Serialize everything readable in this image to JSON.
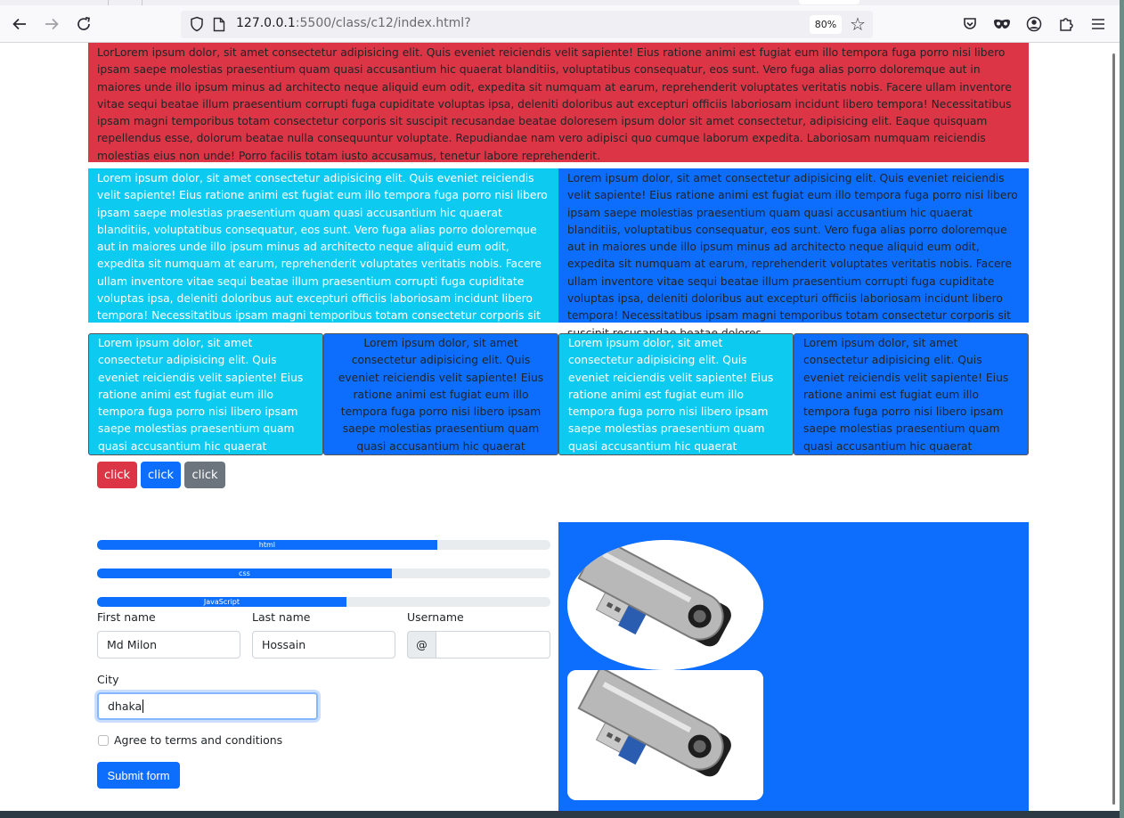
{
  "browser": {
    "url_main": "127.0.0.1",
    "url_rest": ":5500/class/c12/index.html?",
    "zoom": "80%",
    "icons": [
      "back-icon",
      "forward-icon",
      "reload-icon",
      "shield-icon",
      "page-icon",
      "star-icon",
      "pocket-icon",
      "private-mask-icon",
      "account-icon",
      "extensions-icon",
      "menu-icon"
    ]
  },
  "blocks": {
    "red_text": "LorLorem ipsum dolor, sit amet consectetur adipisicing elit. Quis eveniet reiciendis velit sapiente! Eius ratione animi est fugiat eum illo tempora fuga porro nisi libero ipsam saepe molestias praesentium quam quasi accusantium hic quaerat blanditiis, voluptatibus consequatur, eos sunt. Vero fuga alias porro doloremque aut in maiores unde illo ipsum minus ad architecto neque aliquid eum odit, expedita sit numquam at earum, reprehenderit voluptates veritatis nobis. Facere ullam inventore vitae sequi beatae illum praesentium corrupti fuga cupiditate voluptas ipsa, deleniti doloribus aut excepturi officiis laboriosam incidunt libero tempora! Necessitatibus ipsam magni temporibus totam consectetur corporis sit suscipit recusandae beatae doloresem ipsum dolor sit amet consectetur, adipisicing elit. Eaque quisquam repellendus esse, dolorum beatae nulla consequuntur voluptate. Repudiandae nam vero adipisci quo cumque laborum expedita. Laboriosam numquam reiciendis molestias eius non unde! Porro facilis totam iusto accusamus, tenetur labore reprehenderit.",
    "half_text": "Lorem ipsum dolor, sit amet consectetur adipisicing elit. Quis eveniet reiciendis velit sapiente! Eius ratione animi est fugiat eum illo tempora fuga porro nisi libero ipsam saepe molestias praesentium quam quasi accusantium hic quaerat blanditiis, voluptatibus consequatur, eos sunt. Vero fuga alias porro doloremque aut in maiores unde illo ipsum minus ad architecto neque aliquid eum odit, expedita sit numquam at earum, reprehenderit voluptates veritatis nobis. Facere ullam inventore vitae sequi beatae illum praesentium corrupti fuga cupiditate voluptas ipsa, deleniti doloribus aut excepturi officiis laboriosam incidunt libero tempora! Necessitatibus ipsam magni temporibus totam consectetur corporis sit suscipit recusandae beatae dolores.",
    "quarter_1": "Lorem ipsum dolor, sit amet consectetur adipisicing elit. Quis eveniet reiciendis velit sapiente! Eius ratione animi est fugiat eum illo tempora fuga porro nisi libero ipsam saepe molestias praesentium quam quasi accusantium hic quaerat blanditiis, voluptatibus",
    "quarter_2": "Lorem ipsum dolor, sit amet consectetur adipisicing elit. Quis eveniet reiciendis velit sapiente! Eius ratione animi est fugiat eum illo tempora fuga porro nisi libero ipsam saepe molestias praesentium quam quasi accusantium hic quaerat blanditiis, voluptatibus",
    "quarter_3": "Lorem ipsum dolor, sit amet consectetur adipisicing elit. Quis eveniet reiciendis velit sapiente! Eius ratione animi est fugiat eum illo tempora fuga porro nisi libero ipsam saepe molestias praesentium quam quasi accusantium hic quaerat blanditiis, voluptatibus .",
    "quarter_4": "Lorem ipsum dolor, sit amet consectetur adipisicing elit. Quis eveniet reiciendis velit sapiente! Eius ratione animi est fugiat eum illo tempora fuga porro nisi libero ipsam saepe molestias praesentium quam quasi accusantium hic quaerat blanditiis, voluptatibus"
  },
  "buttons": [
    {
      "label": "click",
      "color": "#dc3545"
    },
    {
      "label": "click",
      "color": "#0d6efd"
    },
    {
      "label": "click",
      "color": "#6c757d"
    }
  ],
  "progress": [
    {
      "label": "html",
      "percent": 75
    },
    {
      "label": "css",
      "percent": 65
    },
    {
      "label": "JavaScript",
      "percent": 55
    }
  ],
  "form": {
    "first_name_label": "First name",
    "first_name_value": "Md Milon",
    "last_name_label": "Last name",
    "last_name_value": "Hossain",
    "username_label": "Username",
    "username_prefix": "@",
    "username_value": "",
    "city_label": "City",
    "city_value": "dhaka",
    "agree_label": "Agree to terms and conditions",
    "agree_checked": false,
    "submit_label": "Submit form"
  },
  "colors": {
    "red": "#dc3545",
    "cyan": "#0dcaf0",
    "blue": "#0d6efd",
    "gray": "#6c757d"
  }
}
